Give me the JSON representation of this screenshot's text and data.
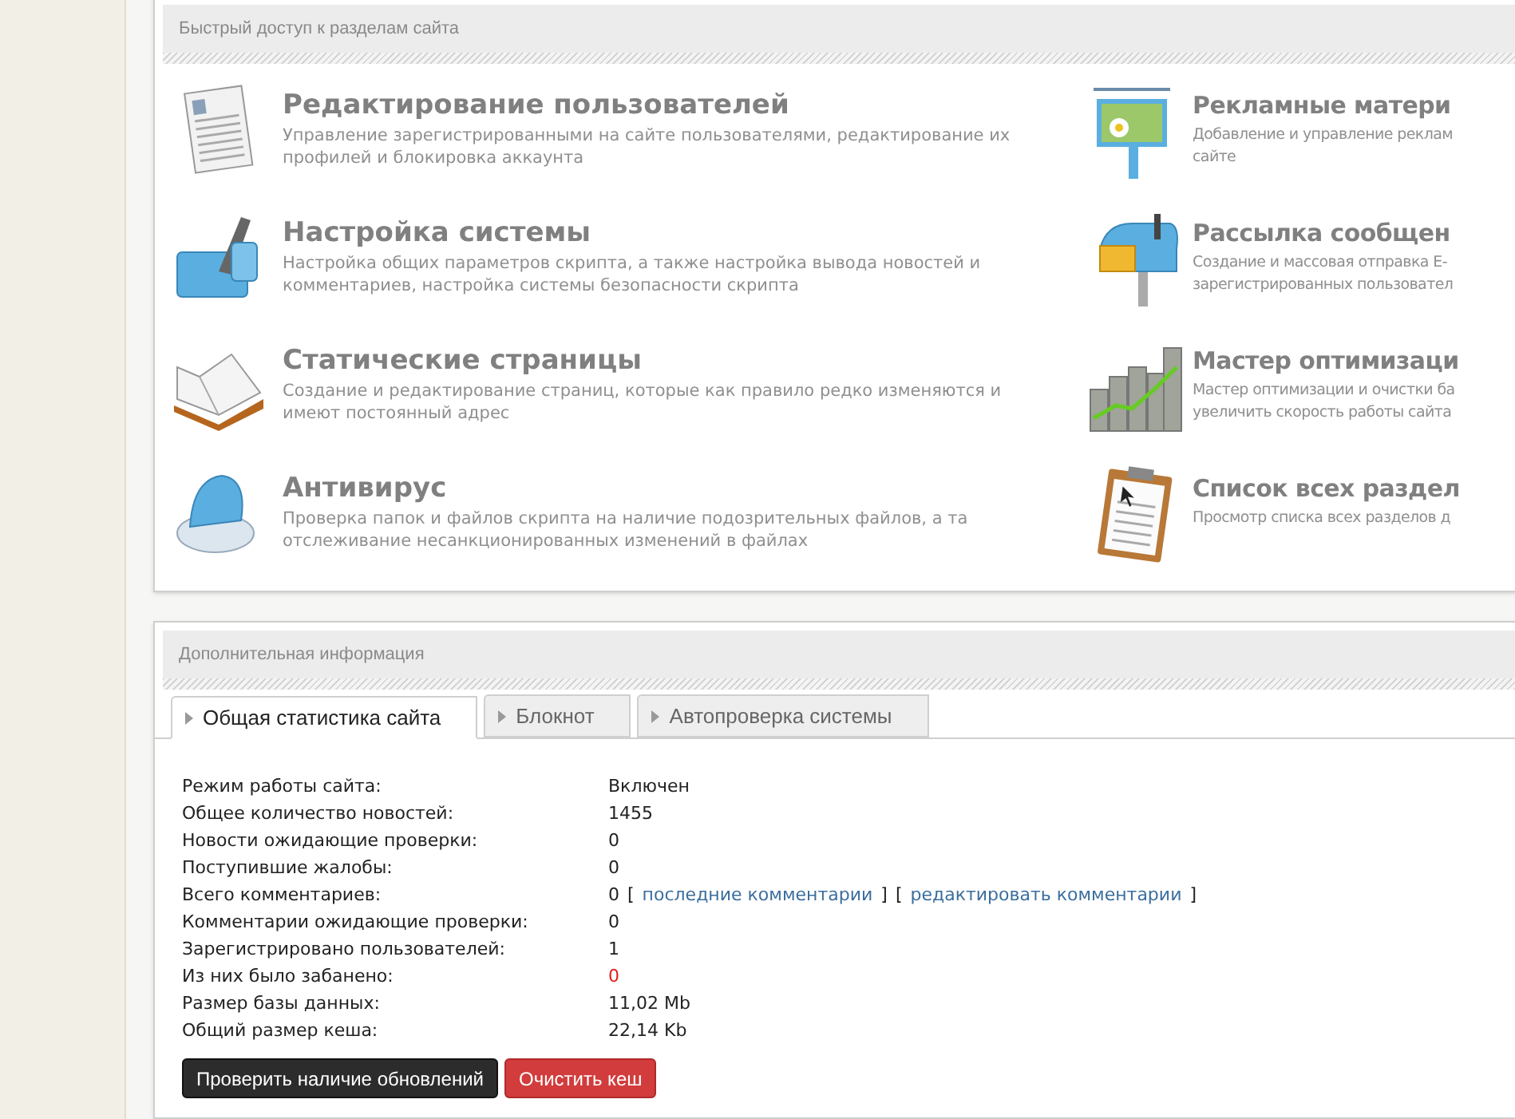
{
  "quick_access": {
    "title": "Быстрый доступ к разделам сайта",
    "columns": [
      [
        {
          "title": "Редактирование пользователей",
          "description": [
            "Управление зарегистрированными на сайте пользователями, редактирование их",
            "профилей и блокировка аккаунта"
          ]
        },
        {
          "title": "Настройка системы",
          "description": [
            "Настройка общих параметров скрипта, а также настройка вывода новостей и",
            "комментариев, настройка системы безопасности скрипта"
          ]
        },
        {
          "title": "Статические страницы",
          "description": [
            "Создание и редактирование страниц, которые как правило редко изменяются и",
            "имеют постоянный адрес"
          ]
        },
        {
          "title": "Антивирус",
          "description": [
            "Проверка папок и файлов скрипта на наличие подозрительных файлов, а та",
            "отслеживание несанкционированных изменений в файлах"
          ]
        }
      ],
      [
        {
          "title": "Рекламные матери",
          "description": [
            "Добавление и управление реклам",
            "сайте"
          ]
        },
        {
          "title": "Рассылка сообщен",
          "description": [
            "Создание и массовая отправка E-",
            "зарегистрированных пользовател"
          ]
        },
        {
          "title": "Мастер оптимизаци",
          "description": [
            "Мастер оптимизации и очистки ба",
            "увеличить скорость работы сайта"
          ]
        },
        {
          "title": "Список всех раздел",
          "description": [
            "Просмотр списка всех разделов д"
          ]
        }
      ]
    ]
  },
  "info": {
    "title": "Дополнительная информация",
    "tabs": [
      {
        "label": "Общая статистика сайта",
        "selected": true
      },
      {
        "label": "Блокнот",
        "selected": false
      },
      {
        "label": "Автопроверка системы",
        "selected": false
      }
    ],
    "stats": [
      {
        "label": "Режим работы сайта:",
        "value": "Включен",
        "alert": false
      },
      {
        "label": "Общее количество новостей:",
        "value": "1455",
        "alert": false
      },
      {
        "label": "Новости ожидающие проверки:",
        "value": "0",
        "alert": false
      },
      {
        "label": "Поступившие жалобы:",
        "value": "0",
        "alert": false
      },
      {
        "label": "Всего комментариев:",
        "value": "0",
        "alert": false,
        "extras": [
          {
            "kind": "bracket",
            "text": "["
          },
          {
            "kind": "link",
            "text": "последние комментарии"
          },
          {
            "kind": "bracket",
            "text": "]"
          },
          {
            "kind": "bracket",
            "text": "["
          },
          {
            "kind": "link",
            "text": "редактировать комментарии"
          },
          {
            "kind": "bracket",
            "text": "]"
          }
        ]
      },
      {
        "label": "Комментарии ожидающие проверки:",
        "value": "0",
        "alert": false
      },
      {
        "label": "Зарегистрировано пользователей:",
        "value": "1",
        "alert": false
      },
      {
        "label": "Из них было забанено:",
        "value": "0",
        "alert": true
      },
      {
        "label": "Размер базы данных:",
        "value": "11,02 Mb",
        "alert": false
      },
      {
        "label": "Общий размер кеша:",
        "value": "22,14 Kb",
        "alert": false
      }
    ],
    "buttons": [
      {
        "label": "Проверить наличие обновлений",
        "kind": "dark"
      },
      {
        "label": "Очистить кеш",
        "kind": "danger"
      }
    ]
  }
}
